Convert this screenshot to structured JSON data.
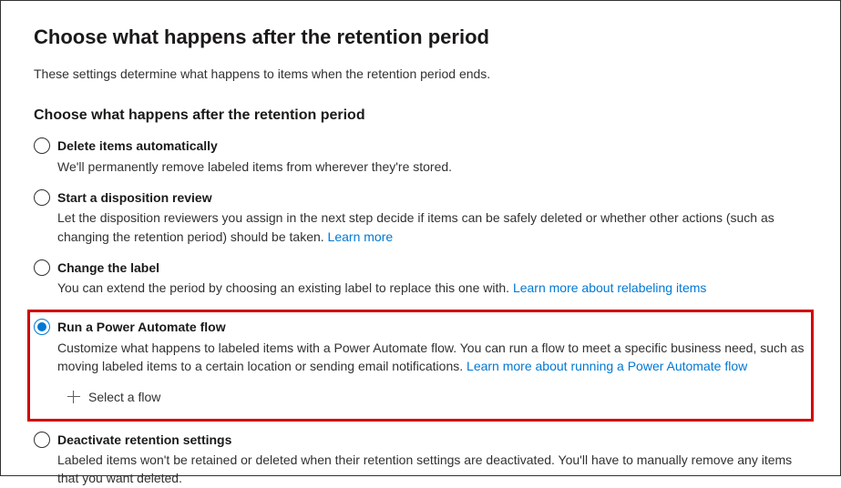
{
  "heading": "Choose what happens after the retention period",
  "subtitle": "These settings determine what happens to items when the retention period ends.",
  "sectionTitle": "Choose what happens after the retention period",
  "options": {
    "delete": {
      "label": "Delete items automatically",
      "desc": "We'll permanently remove labeled items from wherever they're stored."
    },
    "disposition": {
      "label": "Start a disposition review",
      "desc": "Let the disposition reviewers you assign in the next step decide if items can be safely deleted or whether other actions (such as changing the retention period) should be taken.  ",
      "link": "Learn more"
    },
    "changeLabel": {
      "label": "Change the label",
      "desc": "You can extend the period by choosing an existing label to replace this one with. ",
      "link": "Learn more about relabeling items"
    },
    "powerAutomate": {
      "label": "Run a Power Automate flow",
      "desc": "Customize what happens to labeled items with a Power Automate flow. You can run a flow to meet a specific business need, such as moving labeled items to a certain location or sending email notifications. ",
      "link": "Learn more about running a Power Automate flow",
      "selectFlow": "Select a flow"
    },
    "deactivate": {
      "label": "Deactivate retention settings",
      "desc": "Labeled items won't be retained or deleted when their retention settings are deactivated. You'll have to manually remove any items that you want deleted."
    }
  }
}
